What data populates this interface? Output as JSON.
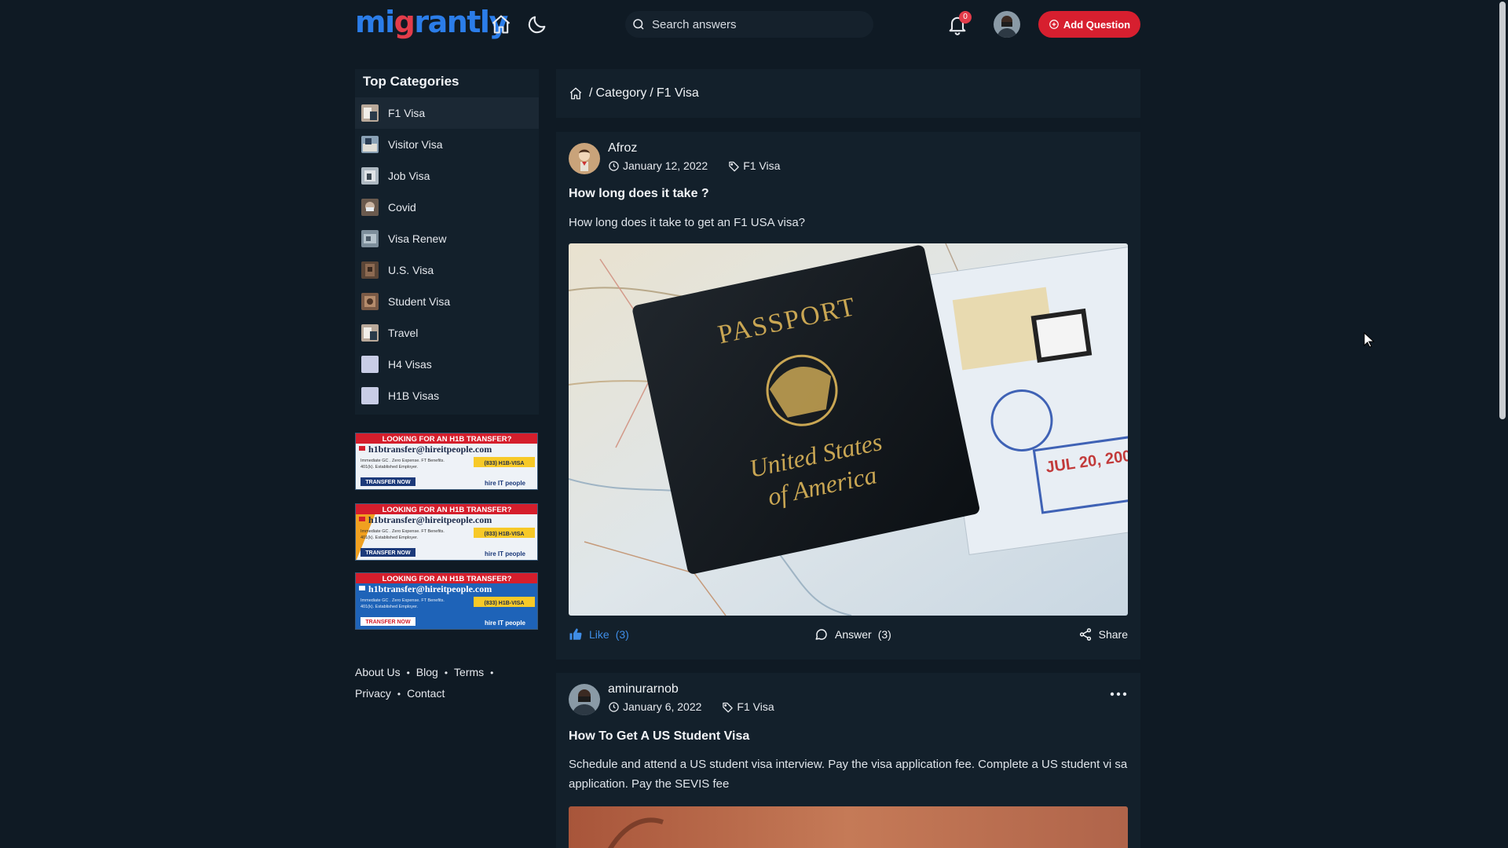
{
  "header": {
    "logo_part1": "mi",
    "logo_part2": "g",
    "logo_part3": "rantly",
    "search_placeholder": "Search answers",
    "notification_count": "0",
    "add_question_label": "Add Question",
    "accent_color": "#d71f2f",
    "brand_blue": "#2b7de9"
  },
  "sidebar": {
    "title": "Top Categories",
    "items": [
      {
        "label": "F1 Visa",
        "active": true
      },
      {
        "label": "Visitor Visa"
      },
      {
        "label": "Job Visa"
      },
      {
        "label": "Covid"
      },
      {
        "label": "Visa Renew"
      },
      {
        "label": "U.S. Visa"
      },
      {
        "label": "Student Visa"
      },
      {
        "label": "Travel"
      },
      {
        "label": "H4 Visas"
      },
      {
        "label": "H1B Visas"
      }
    ],
    "ad": {
      "headline": "LOOKING FOR AN H1B TRANSFER?",
      "email": "h1btransfer@hireitpeople.com",
      "line1": "Immediate GC . Zero Expense. FT Benefits.",
      "line2": "401(k). Established Employer.",
      "phone": "(833) H1B-VISA",
      "cta": "TRANSFER NOW",
      "brand": "hire IT people"
    }
  },
  "footer": {
    "about": "About Us",
    "blog": "Blog",
    "terms": "Terms",
    "privacy": "Privacy",
    "contact": "Contact",
    "separator": "•"
  },
  "breadcrumb": {
    "separator": "/",
    "category": "Category",
    "current": "F1 Visa"
  },
  "posts": [
    {
      "author": "Afroz",
      "date": "January 12, 2022",
      "tag": "F1 Visa",
      "title": "How long does it take ?",
      "body": "How long does it take to get an F1 USA visa?",
      "image_text_1": "PASSPORT",
      "image_text_2": "United States",
      "image_text_3": "of America",
      "like_label": "Like",
      "like_count": "(3)",
      "answer_label": "Answer",
      "answer_count": "(3)",
      "share_label": "Share"
    },
    {
      "author": "aminurarnob",
      "date": "January 6, 2022",
      "tag": "F1 Visa",
      "title": "How To Get A US Student Visa",
      "body": "Schedule and attend a US student visa interview. Pay the visa application fee. Complete a US student vi sa application. Pay the SEVIS fee"
    }
  ]
}
